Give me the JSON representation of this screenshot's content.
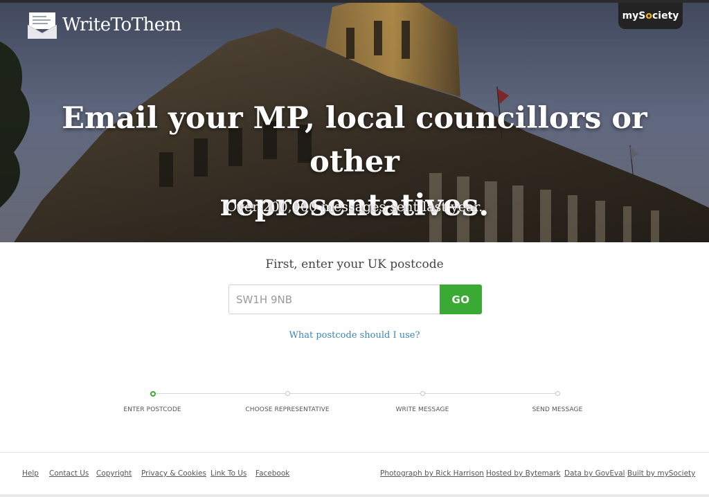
{
  "header": {
    "logo_text": "WriteToThem",
    "partner_badge_prefix": "myS",
    "partner_badge_o": "o",
    "partner_badge_suffix": "ciety"
  },
  "hero": {
    "headline_line1": "Email your MP, local councillors or other",
    "headline_line2": "representatives.",
    "subhead": "Over 200,000 messages sent last year."
  },
  "search": {
    "prompt": "First, enter your UK postcode",
    "placeholder": "SW1H 9NB",
    "button_label": "GO",
    "help_link": "What postcode should I use?"
  },
  "steps": [
    {
      "label": "ENTER POSTCODE",
      "active": true
    },
    {
      "label": "CHOOSE REPRESENTATIVE",
      "active": false
    },
    {
      "label": "WRITE MESSAGE",
      "active": false
    },
    {
      "label": "SEND MESSAGE",
      "active": false
    }
  ],
  "footer": {
    "left_links": [
      "Help",
      "Contact Us",
      "Copyright",
      "Privacy & Cookies",
      "Link To Us",
      "Facebook"
    ],
    "right_links": [
      "Photograph by Rick Harrison",
      "Hosted by Bytemark",
      "Data by GovEval",
      "Built by mySociety"
    ]
  },
  "colors": {
    "accent_green": "#3aaa35",
    "link_blue": "#3a86b8",
    "badge_dark": "#232323",
    "badge_orange": "#f7b018"
  },
  "icons": {
    "logo": "envelope-letter-icon",
    "step_marker": "circle-dot-icon"
  }
}
